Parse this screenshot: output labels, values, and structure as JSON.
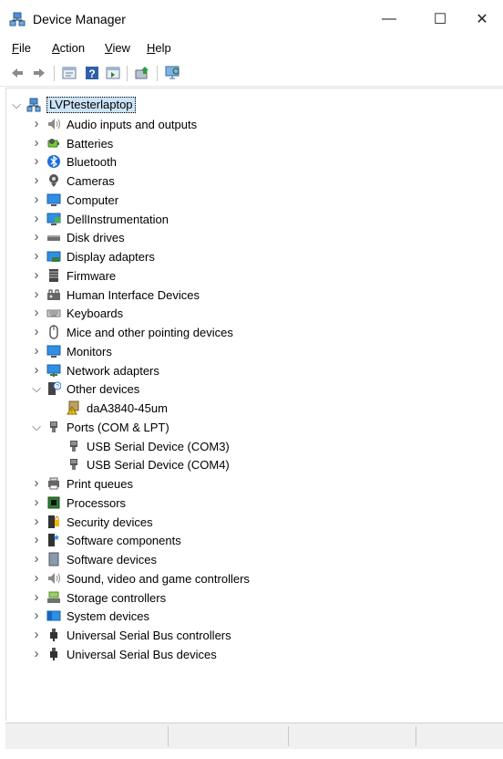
{
  "window": {
    "title": "Device Manager",
    "minimize_glyph": "—",
    "maximize_glyph": "☐",
    "close_glyph": "✕"
  },
  "menu": [
    {
      "label": "File",
      "accel": "F",
      "rest": "ile"
    },
    {
      "label": "Action",
      "accel": "A",
      "rest": "ction"
    },
    {
      "label": "View",
      "accel": "V",
      "rest": "iew"
    },
    {
      "label": "Help",
      "accel": "H",
      "rest": "elp"
    }
  ],
  "toolbar": [
    "back-icon",
    "forward-icon",
    "properties-icon",
    "help-icon",
    "details-icon",
    "update-driver-icon",
    "scan-hardware-icon"
  ],
  "tree": {
    "root": {
      "label": "LVPtesterlaptop",
      "icon": "computer-network-icon",
      "expanded": true
    },
    "items": [
      {
        "label": "Audio inputs and outputs",
        "icon": "speaker-icon",
        "expanded": false
      },
      {
        "label": "Batteries",
        "icon": "battery-icon",
        "expanded": false
      },
      {
        "label": "Bluetooth",
        "icon": "bluetooth-icon",
        "expanded": false
      },
      {
        "label": "Cameras",
        "icon": "camera-icon",
        "expanded": false
      },
      {
        "label": "Computer",
        "icon": "monitor-icon",
        "expanded": false
      },
      {
        "label": "DellInstrumentation",
        "icon": "dell-instrumentation-icon",
        "expanded": false
      },
      {
        "label": "Disk drives",
        "icon": "disk-drive-icon",
        "expanded": false
      },
      {
        "label": "Display adapters",
        "icon": "display-adapter-icon",
        "expanded": false
      },
      {
        "label": "Firmware",
        "icon": "firmware-icon",
        "expanded": false
      },
      {
        "label": "Human Interface Devices",
        "icon": "hid-icon",
        "expanded": false
      },
      {
        "label": "Keyboards",
        "icon": "keyboard-icon",
        "expanded": false
      },
      {
        "label": "Mice and other pointing devices",
        "icon": "mouse-icon",
        "expanded": false
      },
      {
        "label": "Monitors",
        "icon": "monitor-icon",
        "expanded": false
      },
      {
        "label": "Network adapters",
        "icon": "network-adapter-icon",
        "expanded": false
      },
      {
        "label": "Other devices",
        "icon": "unknown-device-icon",
        "expanded": true,
        "children": [
          {
            "label": "daA3840-45um",
            "icon": "warning-device-icon"
          }
        ]
      },
      {
        "label": "Ports (COM & LPT)",
        "icon": "port-icon",
        "expanded": true,
        "children": [
          {
            "label": "USB Serial Device (COM3)",
            "icon": "port-icon"
          },
          {
            "label": "USB Serial Device (COM4)",
            "icon": "port-icon"
          }
        ]
      },
      {
        "label": "Print queues",
        "icon": "printer-icon",
        "expanded": false
      },
      {
        "label": "Processors",
        "icon": "processor-icon",
        "expanded": false
      },
      {
        "label": "Security devices",
        "icon": "security-device-icon",
        "expanded": false
      },
      {
        "label": "Software components",
        "icon": "software-component-icon",
        "expanded": false
      },
      {
        "label": "Software devices",
        "icon": "software-device-icon",
        "expanded": false
      },
      {
        "label": "Sound, video and game controllers",
        "icon": "speaker-icon",
        "expanded": false
      },
      {
        "label": "Storage controllers",
        "icon": "storage-controller-icon",
        "expanded": false
      },
      {
        "label": "System devices",
        "icon": "system-devices-icon",
        "expanded": false
      },
      {
        "label": "Universal Serial Bus controllers",
        "icon": "usb-icon",
        "expanded": false
      },
      {
        "label": "Universal Serial Bus devices",
        "icon": "usb-icon",
        "expanded": false
      }
    ]
  },
  "colors": {
    "selection": "#cce4f7",
    "accent": "#0063b1"
  }
}
